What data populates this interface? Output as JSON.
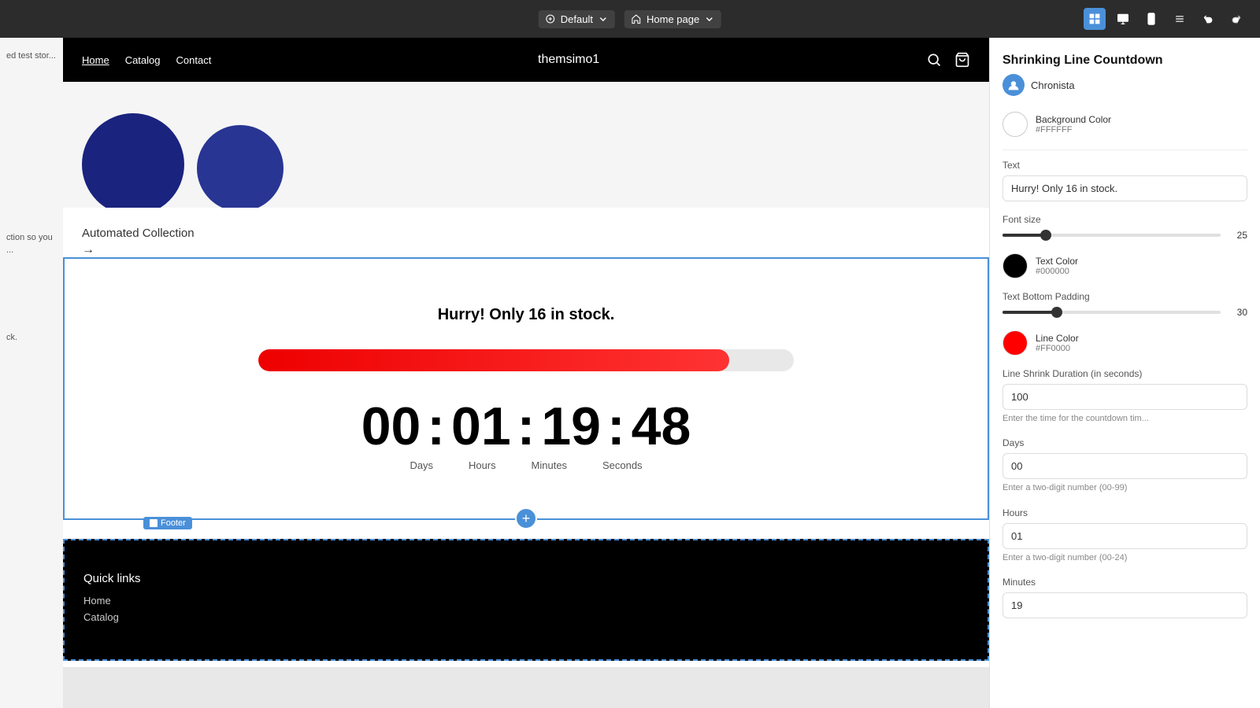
{
  "toolbar": {
    "default_label": "Default",
    "homepage_label": "Home page",
    "undo_label": "Undo",
    "redo_label": "Redo"
  },
  "left_strip": {
    "texts": [
      "ction so you ...",
      "ck."
    ]
  },
  "store": {
    "nav": {
      "links": [
        "Home",
        "Catalog",
        "Contact"
      ],
      "brand": "themsimo1"
    },
    "automated_collection": {
      "title": "Automated Collection",
      "arrow": "→"
    },
    "countdown": {
      "title": "Hurry! Only 16 in stock.",
      "progress_percent": 88,
      "timer": {
        "days": "00",
        "hours": "01",
        "minutes": "19",
        "seconds": "48",
        "labels": [
          "Days",
          "Hours",
          "Minutes",
          "Seconds"
        ]
      }
    },
    "footer": {
      "badge_label": "Footer",
      "quick_links_title": "Quick links",
      "links": [
        "Home",
        "Catalog"
      ]
    }
  },
  "right_panel": {
    "title": "Shrinking Line Countdown",
    "author": "Chronista",
    "background_color": {
      "label": "Background Color",
      "hex": "#FFFFFF",
      "swatch": "#FFFFFF"
    },
    "text_section": {
      "label": "Text",
      "value": "Hurry! Only 16 in stock."
    },
    "font_size": {
      "label": "Font size",
      "value": 25,
      "slider_percent": 20
    },
    "text_color": {
      "label": "Text Color",
      "hex": "#000000",
      "swatch": "#000000"
    },
    "text_bottom_padding": {
      "label": "Text Bottom Padding",
      "value": 30,
      "slider_percent": 25
    },
    "line_color": {
      "label": "Line Color",
      "hex": "#FF0000",
      "swatch": "#FF0000"
    },
    "line_shrink_duration": {
      "label": "Line Shrink Duration (in seconds)",
      "value": "100",
      "help": "Enter the time for the countdown tim..."
    },
    "days": {
      "label": "Days",
      "value": "00",
      "help": "Enter a two-digit number (00-99)"
    },
    "hours": {
      "label": "Hours",
      "value": "01",
      "help": "Enter a two-digit number (00-24)"
    },
    "minutes": {
      "label": "Minutes",
      "value": "19",
      "help_label": "Minutes"
    }
  }
}
